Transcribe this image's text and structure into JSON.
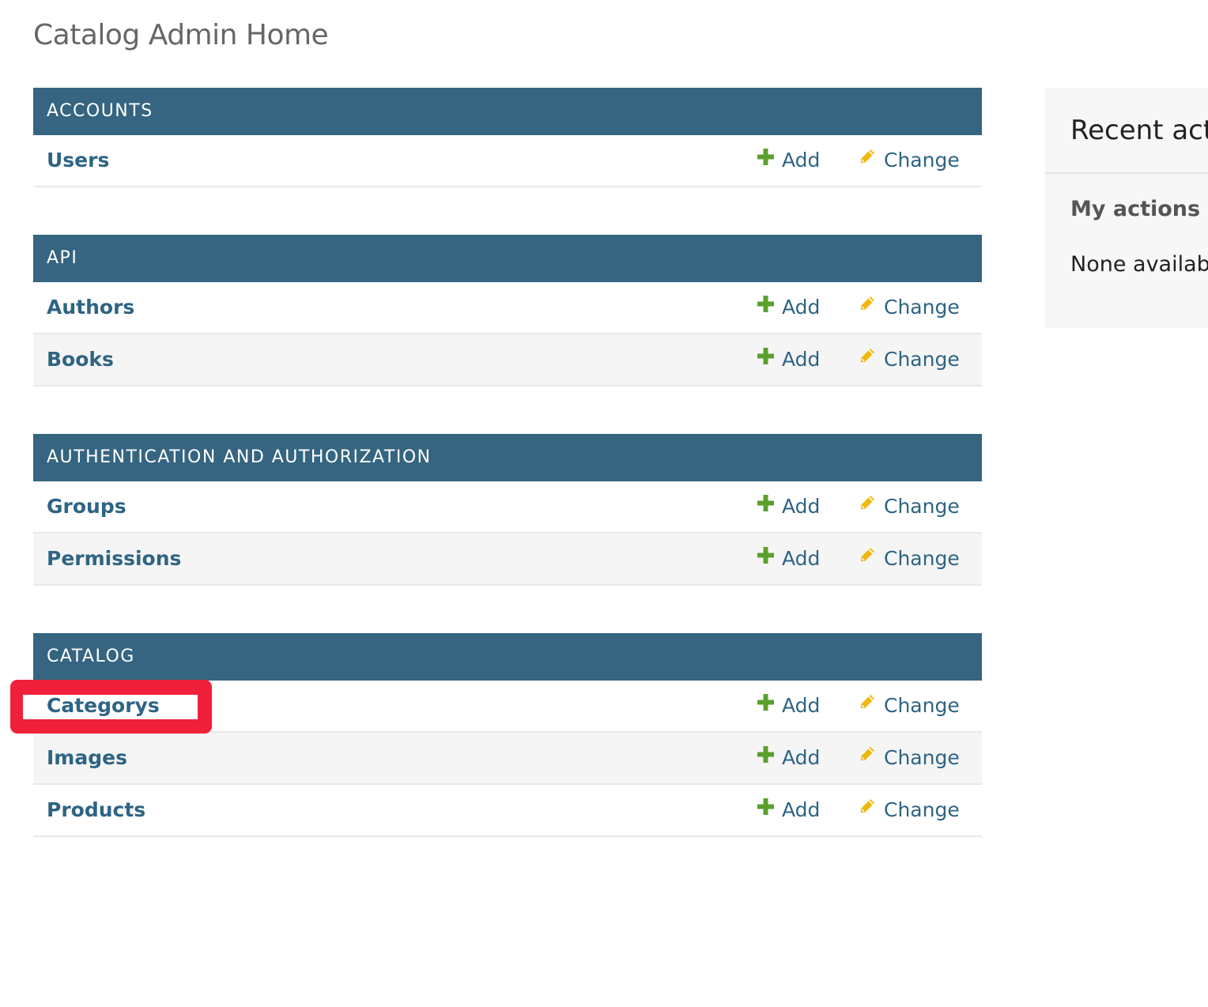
{
  "page": {
    "title": "Catalog Admin Home"
  },
  "modules": [
    {
      "name": "ACCOUNTS",
      "models": [
        {
          "name": "Users"
        }
      ]
    },
    {
      "name": "API",
      "models": [
        {
          "name": "Authors"
        },
        {
          "name": "Books"
        }
      ]
    },
    {
      "name": "AUTHENTICATION AND AUTHORIZATION",
      "models": [
        {
          "name": "Groups"
        },
        {
          "name": "Permissions"
        }
      ]
    },
    {
      "name": "CATALOG",
      "models": [
        {
          "name": "Categorys"
        },
        {
          "name": "Images"
        },
        {
          "name": "Products"
        }
      ]
    }
  ],
  "actions": {
    "add_label": "Add",
    "change_label": "Change"
  },
  "recent_actions": {
    "title": "Recent actions",
    "subtitle": "My actions",
    "empty_text": "None available"
  },
  "icons": {
    "add": "plus-icon",
    "change": "pencil-icon"
  },
  "colors": {
    "module_header": "#356580",
    "link": "#2e6484",
    "add_icon": "#5aa02c",
    "change_icon": "#efb80b",
    "highlight": "#f0203a"
  },
  "highlighted_item": "Categorys"
}
